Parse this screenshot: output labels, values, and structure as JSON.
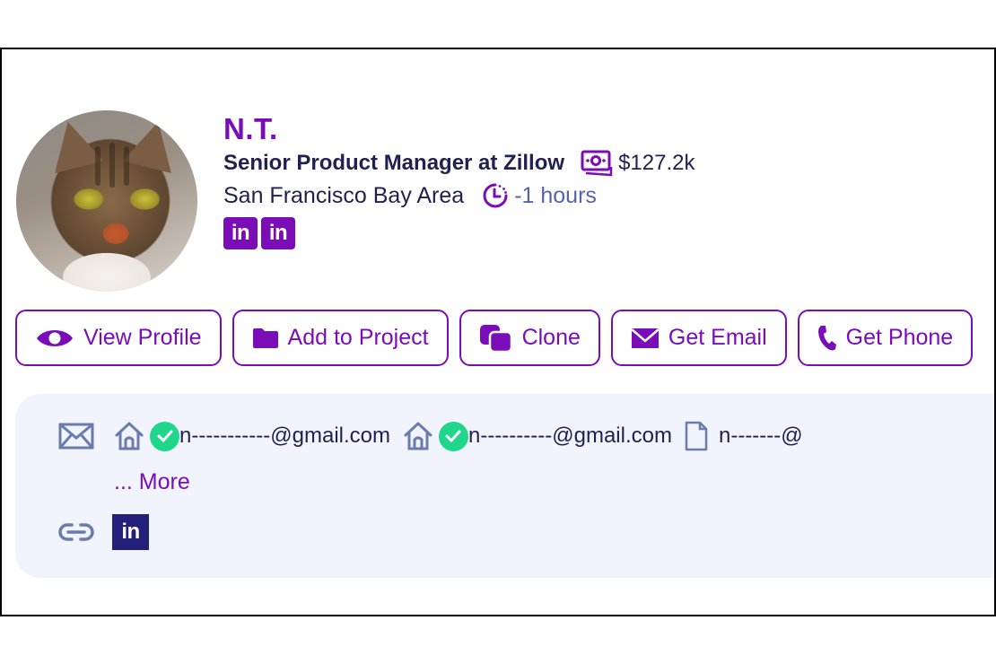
{
  "profile": {
    "name": "N.T.",
    "title": "Senior Product Manager at Zillow",
    "salary": "$127.2k",
    "location": "San Francisco Bay Area",
    "local_time": "-1 hours",
    "avatar_alt": "tabby cat profile photo",
    "social_links": [
      {
        "icon": "linkedin-icon",
        "label": "in"
      },
      {
        "icon": "linkedin-icon",
        "label": "in"
      }
    ]
  },
  "actions": [
    {
      "id": "view-profile",
      "icon": "eye-icon",
      "label": "View Profile"
    },
    {
      "id": "add-to-project",
      "icon": "folder-icon",
      "label": "Add to Project"
    },
    {
      "id": "clone",
      "icon": "clone-icon",
      "label": "Clone"
    },
    {
      "id": "get-email",
      "icon": "envelope-icon",
      "label": "Get Email"
    },
    {
      "id": "get-phone",
      "icon": "phone-icon",
      "label": "Get Phone"
    }
  ],
  "contact": {
    "emails": [
      {
        "type": "personal",
        "type_icon": "home-icon",
        "verified": true,
        "value": "n-----------@gmail.com"
      },
      {
        "type": "personal",
        "type_icon": "home-icon",
        "verified": true,
        "value": "n----------@gmail.com"
      },
      {
        "type": "document",
        "type_icon": "file-icon",
        "verified": false,
        "value": "n-------@"
      }
    ],
    "more_label": "... More",
    "links": [
      {
        "icon": "linkedin-icon",
        "label": "in"
      }
    ]
  },
  "colors": {
    "accent": "#7a0db8",
    "text_dark": "#1f214f",
    "muted_blue": "#5563ad",
    "icon_gray_blue": "#6a7bad",
    "verified_green": "#1fd68a",
    "card_bg": "#f1f4fc",
    "linkedin_navy": "#23207a"
  }
}
